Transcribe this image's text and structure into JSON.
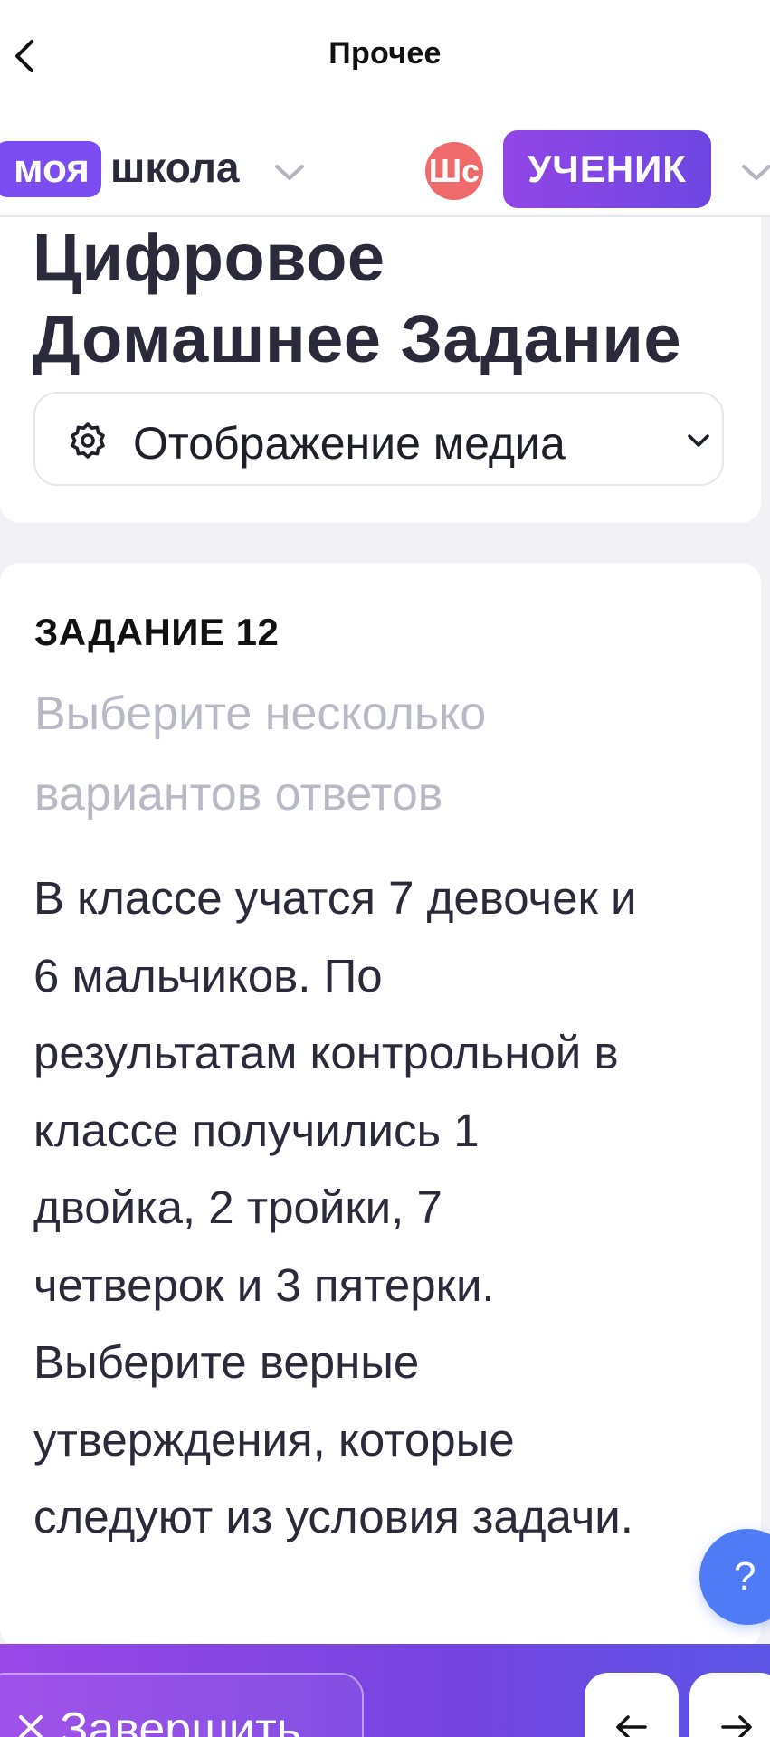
{
  "navbar": {
    "title": "Прочее"
  },
  "brand": {
    "part1": "моя",
    "part2": "школа"
  },
  "user": {
    "avatar_text": "Шс",
    "role": "УЧЕНИК"
  },
  "header": {
    "title_line1": "Цифровое",
    "title_line2": "Домашнее Задание",
    "media_select_label": "Отображение медиа"
  },
  "task": {
    "number": "ЗАДАНИЕ 12",
    "hint_line1": "Выберите несколько",
    "hint_line2": "вариантов ответов",
    "text_lines": [
      "В классе учатся 7 девочек и",
      "6 мальчиков. По",
      "результатам контрольной в",
      "классе получились 1",
      "двойка, 2 тройки, 7",
      "четверок и 3 пятерки.",
      "Выберите верные",
      "утверждения, которые",
      "следуют из условия задачи."
    ]
  },
  "help": {
    "label": "?"
  },
  "footer": {
    "finish_label": "Завершить"
  },
  "icons": {
    "back": "chevron-left-icon",
    "brand_dropdown": "chevron-down-icon",
    "role_dropdown": "chevron-down-icon",
    "media": "gear-icon",
    "finish": "close-icon",
    "prev": "arrow-left-icon",
    "next": "arrow-right-icon"
  },
  "colors": {
    "accent": "#7b4df0",
    "role_gradient_start": "#9246e6",
    "role_gradient_end": "#6d46e2",
    "avatar": "#ef6a6a",
    "help": "#4f7cf6",
    "hint_text": "#b9b9c6",
    "body_text": "#2a2a3a",
    "background": "#f2f2f6"
  }
}
